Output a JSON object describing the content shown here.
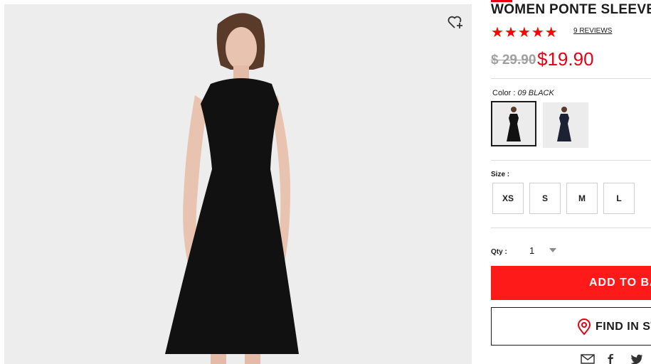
{
  "product": {
    "title": "WOMEN PONTE SLEEVELESS FLARE DRESS",
    "rating_stars": 5,
    "reviews_label": "9 REVIEWS",
    "original_price": "$ 29.90",
    "sale_price": "$19.90"
  },
  "color": {
    "label": "Color :",
    "selected": "09 BLACK",
    "swatches": [
      "BLACK",
      "NAVY"
    ]
  },
  "size": {
    "label": "Size :",
    "options": [
      "XS",
      "S",
      "M",
      "L"
    ]
  },
  "quantity": {
    "label": "Qty :",
    "value": "1"
  },
  "actions": {
    "add_to_bag": "ADD TO BAG",
    "find_in_store": "FIND IN STORE"
  },
  "icons": {
    "wishlist": "heart-plus-icon",
    "store": "map-pin-icon",
    "share": [
      "email-icon",
      "facebook-icon",
      "twitter-icon"
    ]
  },
  "colors": {
    "accent": "#ff1a1a",
    "price_sale": "#e60012",
    "star": "#ff0000",
    "dress": "#111111",
    "background": "#eeeeee"
  }
}
